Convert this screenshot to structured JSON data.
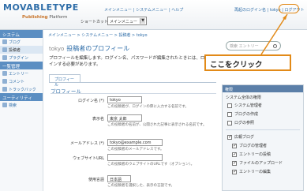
{
  "header": {
    "logo_text": "MOVABLETYPE",
    "logo_sub_accent": "Publishing",
    "logo_sub_rest": " Platform",
    "nav": [
      "メインメニュー",
      "システムメニュー",
      "ヘルプ"
    ],
    "shortcut_label": "ショートカット",
    "main_menu_value": "メインメニュー",
    "user_links": "再起のログイン名 | tokyo | ログアウト"
  },
  "sidebar": {
    "system_head": "システム",
    "items_top": [
      {
        "label": "ブログ",
        "icon": "blog-icon"
      },
      {
        "label": "投稿者",
        "icon": "author-icon"
      },
      {
        "label": "プラグイン",
        "icon": "plugin-icon"
      }
    ],
    "list_head": "一覧管理",
    "items_mid": [
      {
        "label": "エントリー",
        "icon": "entry-icon"
      },
      {
        "label": "コメント",
        "icon": "comment-icon"
      },
      {
        "label": "トラックバック",
        "icon": "trackback-icon"
      }
    ],
    "utility_head": "ユーティリティ",
    "items_bottom": [
      {
        "label": "検索",
        "icon": "search-icon"
      }
    ]
  },
  "main": {
    "breadcrumb": "メインメニュー > システムメニュー > 投稿者 > tokyo",
    "title_blog": "tokyo",
    "title": "投稿者のプロフィール",
    "search_placeholder": "検索 エントリー",
    "intro": "プロフィールを編集します。ログイン名、パスワードが編集されたときには、ログ再度ログインする必要があります。",
    "tab_profile": "プロフィール",
    "section_title": "プロフィール",
    "fields": {
      "login": {
        "label": "ログイン名 (*)",
        "value": "tokyo",
        "help": "この投稿者が、ログインの際に入力する名前です。"
      },
      "display": {
        "label": "表示名",
        "value": "東京 太郎",
        "help": "この投稿者の名前が、公開された記事に表示される名前です。"
      },
      "email": {
        "label": "メールアドレス (*)",
        "value": "tokyo@example.com",
        "help": "この投稿者のメールアドレスです。"
      },
      "url": {
        "label": "ウェブサイトURL",
        "value": "",
        "help": "この投稿者のウェブサイトのURLです（オプション）。"
      },
      "lang": {
        "label": "使用言語",
        "value": "日本語",
        "help": "この投稿者を選択した、表示の言語です。"
      }
    }
  },
  "privileges": {
    "head": "権限",
    "sub": "システム全体の権限",
    "items": [
      {
        "label": "システム管理者",
        "checked": false
      },
      {
        "label": "ブログの作成",
        "checked": false
      },
      {
        "label": "ログの参照",
        "checked": false
      }
    ],
    "blog_items": [
      {
        "label": "広報ブログ",
        "checked": true,
        "sub": false
      },
      {
        "label": "ブログの管理者",
        "checked": true,
        "sub": true
      },
      {
        "label": "エントリーの投稿",
        "checked": true,
        "sub": true
      },
      {
        "label": "ファイルのアップロード",
        "checked": true,
        "sub": true
      },
      {
        "label": "エントリーの編集",
        "checked": true,
        "sub": true
      }
    ]
  },
  "callout": {
    "text": "ここをクリック",
    "color": "#e28a18"
  }
}
